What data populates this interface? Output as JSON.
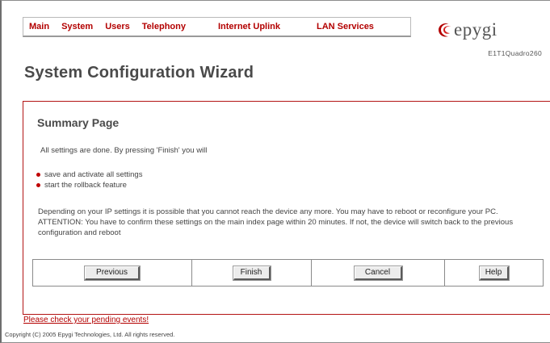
{
  "nav": {
    "items": [
      {
        "label": "Main"
      },
      {
        "label": "System"
      },
      {
        "label": "Users"
      },
      {
        "label": "Telephony"
      },
      {
        "label": "Internet Uplink"
      },
      {
        "label": "LAN Services"
      }
    ]
  },
  "brand": {
    "logo_text": "epygi",
    "model": "E1T1Quadro260",
    "accent_color": "#b30000"
  },
  "page": {
    "title": "System Configuration Wizard"
  },
  "panel": {
    "title": "Summary Page",
    "intro": "All settings are done. By pressing 'Finish' you will",
    "bullets": [
      "save and activate all settings",
      "start the rollback feature"
    ],
    "info_line1": "Depending on your IP settings it is possible that you cannot reach the device any more. You may have to reboot or reconfigure your PC.",
    "info_line2": "ATTENTION: You have to confirm these settings on the main index page within 20 minutes. If not, the device will switch back to the previous configuration and reboot"
  },
  "buttons": {
    "previous": "Previous",
    "finish": "Finish",
    "cancel": "Cancel",
    "help": "Help"
  },
  "footer": {
    "pending_link": "Please check your pending events!",
    "copyright": "Copyright (C) 2005 Epygi Technologies, Ltd. All rights reserved."
  }
}
